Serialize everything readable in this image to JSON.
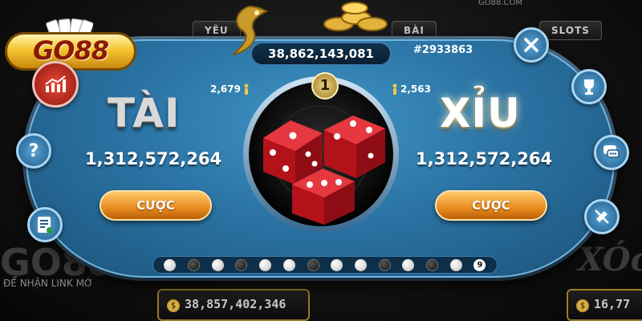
{
  "background": {
    "tabs": [
      "YÊU",
      "BÀI",
      "SLOTS"
    ],
    "brand_text": "GO88",
    "brand_subtext": "ĐỂ NHẬN LINK MỚ",
    "site_text": "GO88.COM",
    "jackpot_card_left": "38,857,402,346",
    "jackpot_card_right": "16,77",
    "right_logo": "XÓc"
  },
  "logo": {
    "text": "GO88"
  },
  "header": {
    "jackpot": "38,862,143,081",
    "session_id": "#2933863"
  },
  "round": {
    "number": "1"
  },
  "tai": {
    "title": "TÀI",
    "total": "1,312,572,264",
    "players": "2,679",
    "bet_label": "CƯỢC"
  },
  "xiu": {
    "title": "XỈU",
    "total": "1,312,572,264",
    "players": "2,563",
    "bet_label": "CƯỢC"
  },
  "history": {
    "results": [
      "white",
      "black",
      "white",
      "black",
      "white",
      "white",
      "black",
      "white",
      "white",
      "black",
      "white",
      "black",
      "white"
    ],
    "last_value": "9"
  },
  "side_buttons": {
    "left": [
      "stats-icon",
      "help-icon",
      "rules-icon"
    ],
    "right": [
      "close-icon",
      "trophy-icon",
      "chat-icon",
      "mute-icon"
    ]
  },
  "colors": {
    "felt": "#2b74a5",
    "bet_button": "#e98b1f",
    "logo_gold": "#f4c430",
    "dice_red": "#d11a23"
  }
}
